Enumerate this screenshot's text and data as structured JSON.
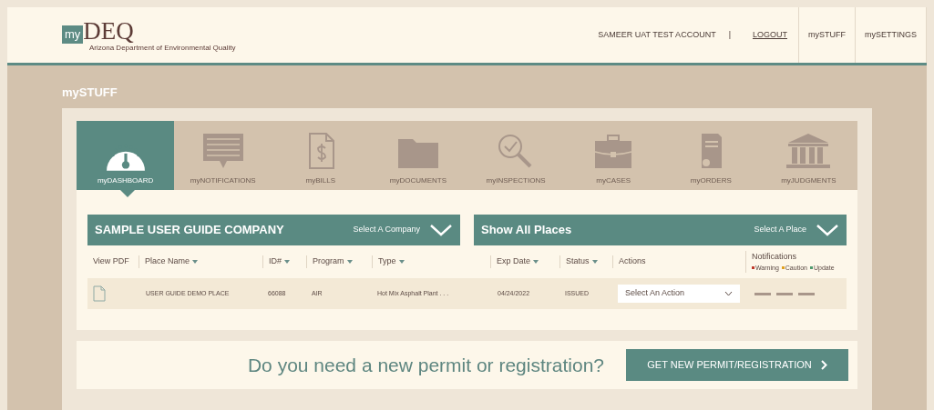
{
  "header": {
    "logo": {
      "badge": "my",
      "name": "DEQ",
      "subtitle": "Arizona Department of Environmental Quality"
    },
    "account": "SAMEER UAT TEST ACCOUNT",
    "separator": "|",
    "links": [
      {
        "label": "LOGOUT",
        "kind": "underlined"
      },
      {
        "label": "mySTUFF",
        "kind": "boxed"
      },
      {
        "label": "mySETTINGS",
        "kind": "boxed"
      }
    ]
  },
  "page_title": "mySTUFF",
  "tabs": [
    {
      "label": "myDASHBOARD",
      "selected": true
    },
    {
      "label": "myNOTIFICATIONS",
      "selected": false
    },
    {
      "label": "myBILLS",
      "selected": false
    },
    {
      "label": "myDOCUMENTS",
      "selected": false
    },
    {
      "label": "myINSPECTIONS",
      "selected": false
    },
    {
      "label": "myCASES",
      "selected": false
    },
    {
      "label": "myORDERS",
      "selected": false
    },
    {
      "label": "myJUDGMENTS",
      "selected": false
    }
  ],
  "selectors": [
    {
      "title": "SAMPLE USER GUIDE COMPANY",
      "prompt": "Select A Company"
    },
    {
      "title": "Show All Places",
      "prompt": "Select A Place"
    }
  ],
  "table": {
    "columns": [
      {
        "label": "View PDF",
        "sortable": false
      },
      {
        "label": "Place Name",
        "sortable": true
      },
      {
        "label": "ID#",
        "sortable": true
      },
      {
        "label": "Program",
        "sortable": true
      },
      {
        "label": "Type",
        "sortable": true
      },
      {
        "label": "Exp Date",
        "sortable": true
      },
      {
        "label": "Status",
        "sortable": true
      },
      {
        "label": "Actions",
        "sortable": false
      },
      {
        "label": "Notifications",
        "sortable": false
      }
    ],
    "legend": [
      {
        "label": "Warning",
        "color": "#c0392b"
      },
      {
        "label": "Caution",
        "color": "#e0a020"
      },
      {
        "label": "Update",
        "color": "#4f9a6e"
      }
    ],
    "rows": [
      {
        "place_name": "USER GUIDE DEMO PLACE",
        "id": "66088",
        "program": "AIR",
        "type": "Hot Mix Asphalt Plant . . .",
        "exp_date": "04/24/2022",
        "status": "ISSUED",
        "action": "Select An Action"
      }
    ]
  },
  "permit_prompt": {
    "question": "Do you need a new permit or registration?",
    "button": "GET NEW PERMIT/REGISTRATION"
  }
}
